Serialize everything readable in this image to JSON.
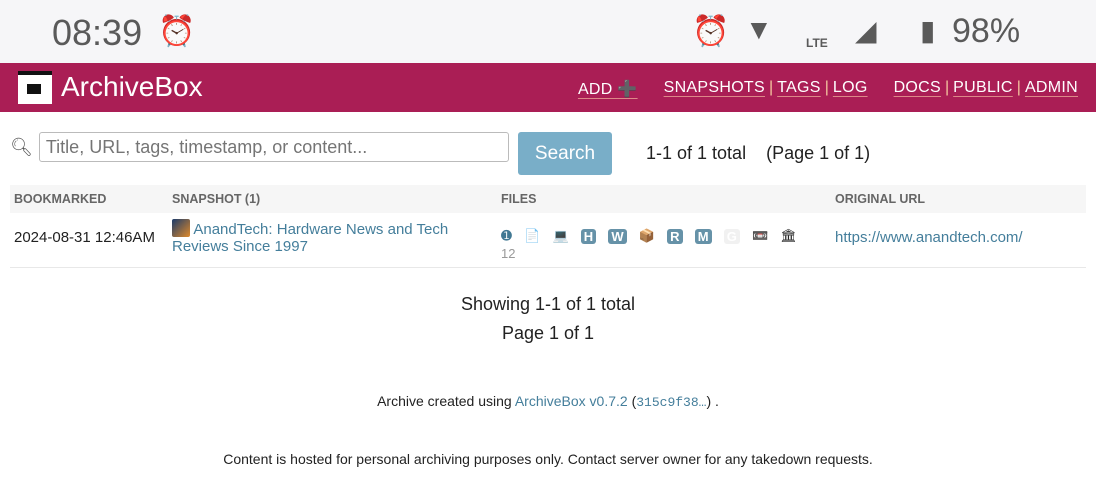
{
  "status_bar": {
    "time": "08:39",
    "battery": "98%",
    "network": "LTE"
  },
  "header": {
    "brand": "ArchiveBox",
    "nav": [
      "ADD ➕",
      "SNAPSHOTS",
      "TAGS",
      "LOG",
      "DOCS",
      "PUBLIC",
      "ADMIN"
    ]
  },
  "search": {
    "placeholder": "Title, URL, tags, timestamp, or content...",
    "button": "Search",
    "count": "1-1 of 1 total",
    "page": "(Page 1 of 1)"
  },
  "table": {
    "headers": [
      "BOOKMARKED",
      "SNAPSHOT (1)",
      "FILES",
      "ORIGINAL URL"
    ],
    "rows": [
      {
        "bookmarked": "2024-08-31 12:46AM",
        "title": "AnandTech: Hardware News and Tech Reviews Since 1997",
        "files": [
          "➊",
          "📄",
          "💻",
          "H",
          "W",
          "📦",
          "R",
          "M",
          "G",
          "📼",
          "🏛"
        ],
        "files_count": "12",
        "url": "https://www.anandtech.com/"
      }
    ]
  },
  "pagination": {
    "showing": "Showing 1-1 of 1 total",
    "page": "Page 1 of 1"
  },
  "footer": {
    "prefix": "Archive created using",
    "link": "ArchiveBox v0.7.2",
    "hash": "315c9f38…",
    "disclaimer": "Content is hosted for personal archiving purposes only. Contact server owner for any takedown requests."
  }
}
